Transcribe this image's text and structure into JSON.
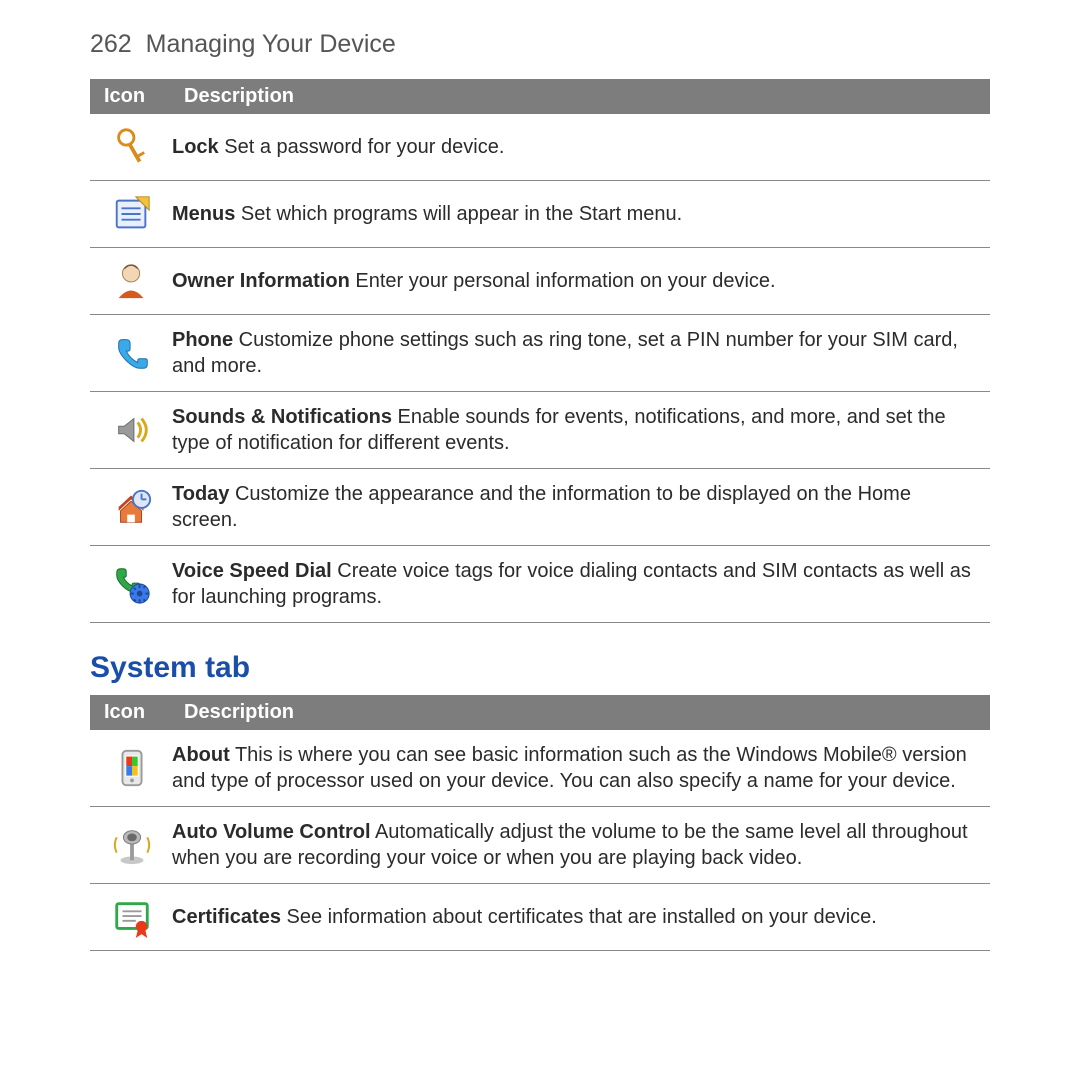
{
  "page": {
    "number": "262",
    "title": "Managing Your Device"
  },
  "table1": {
    "header_icon": "Icon",
    "header_desc": "Description",
    "rows": [
      {
        "icon": "key-icon",
        "bold": "Lock",
        "text": "  Set a password for your device."
      },
      {
        "icon": "menus-icon",
        "bold": "Menus",
        "text": "  Set which programs will appear in the Start menu."
      },
      {
        "icon": "owner-icon",
        "bold": "Owner Information",
        "text": "  Enter your personal information on your device."
      },
      {
        "icon": "phone-icon",
        "bold": "Phone",
        "text": "  Customize phone settings such as ring tone, set a PIN number for your SIM card, and more."
      },
      {
        "icon": "sounds-icon",
        "bold": "Sounds & Notifications",
        "text": "  Enable sounds for events, notifications, and more, and set the type of notification for different events."
      },
      {
        "icon": "today-icon",
        "bold": "Today",
        "text": "  Customize the appearance and the information to be displayed on the Home screen."
      },
      {
        "icon": "voice-speed-dial-icon",
        "bold": "Voice Speed Dial",
        "text": "  Create voice tags for voice dialing contacts and SIM contacts as well as for launching programs."
      }
    ]
  },
  "section2_heading": "System tab",
  "table2": {
    "header_icon": "Icon",
    "header_desc": "Description",
    "rows": [
      {
        "icon": "about-icon",
        "bold": "About",
        "text": "  This is where you can see basic information such as the Windows Mobile® version and type of processor used on your device. You can also specify a name for your device."
      },
      {
        "icon": "auto-volume-icon",
        "bold": "Auto Volume Control",
        "text": "  Automatically adjust the volume to be the same level all throughout when you are recording your voice or when you are playing back video."
      },
      {
        "icon": "certificates-icon",
        "bold": "Certificates",
        "text": "  See information about certificates that are installed on your device."
      }
    ]
  }
}
